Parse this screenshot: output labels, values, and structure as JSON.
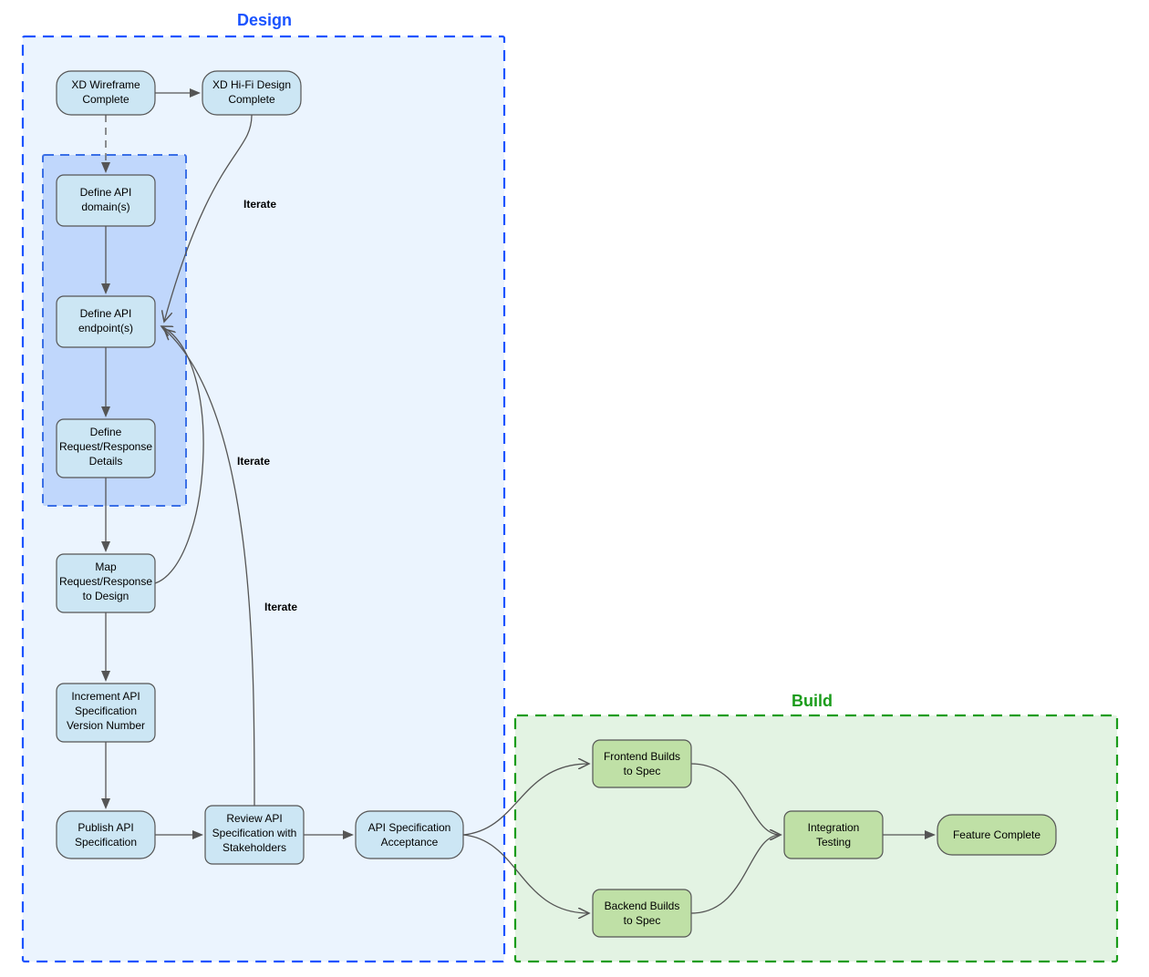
{
  "groups": {
    "design": {
      "title": "Design"
    },
    "build": {
      "title": "Build"
    }
  },
  "nodes": {
    "wireframe": {
      "line1": "XD Wireframe",
      "line2": "Complete"
    },
    "hifi": {
      "line1": "XD Hi-Fi Design",
      "line2": "Complete"
    },
    "defineDomain": {
      "line1": "Define API",
      "line2": "domain(s)"
    },
    "defineEndpoints": {
      "line1": "Define API",
      "line2": "endpoint(s)"
    },
    "defineDetails": {
      "line1": "Define",
      "line2": "Request/Response",
      "line3": "Details"
    },
    "mapDesign": {
      "line1": "Map",
      "line2": "Request/Response",
      "line3": "to Design"
    },
    "incrementVersion": {
      "line1": "Increment API",
      "line2": "Specification",
      "line3": "Version Number"
    },
    "publish": {
      "line1": "Publish API",
      "line2": "Specification"
    },
    "review": {
      "line1": "Review API",
      "line2": "Specification with",
      "line3": "Stakeholders"
    },
    "acceptance": {
      "line1": "API Specification",
      "line2": "Acceptance"
    },
    "frontend": {
      "line1": "Frontend Builds",
      "line2": "to Spec"
    },
    "backend": {
      "line1": "Backend Builds",
      "line2": "to Spec"
    },
    "integration": {
      "line1": "Integration",
      "line2": "Testing"
    },
    "featureComplete": {
      "line1": "Feature Complete"
    }
  },
  "labels": {
    "iterate1": "Iterate",
    "iterate2": "Iterate",
    "iterate3": "Iterate"
  }
}
